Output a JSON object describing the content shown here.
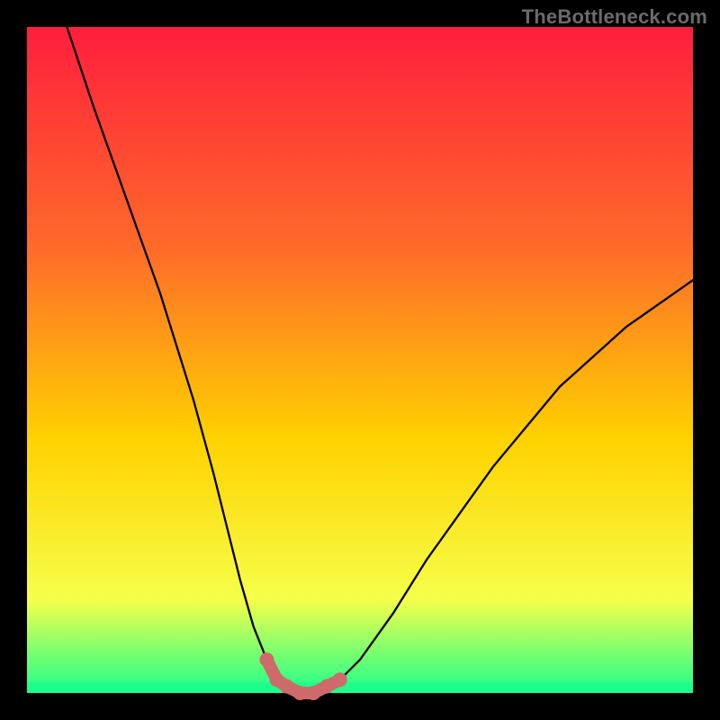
{
  "domain": "Chart",
  "watermark": "TheBottleneck.com",
  "colors": {
    "background": "#000000",
    "gradient_top": "#ff1e3d",
    "gradient_mid1": "#ff6a2a",
    "gradient_mid2": "#ffd200",
    "gradient_mid3": "#f5ff4a",
    "gradient_bottom": "#1cff8c",
    "curve": "#000000",
    "bottom_highlight": "#cf6a6a"
  },
  "chart_data": {
    "type": "line",
    "title": "",
    "xlabel": "",
    "ylabel": "",
    "xlim": [
      0,
      100
    ],
    "ylim": [
      0,
      100
    ],
    "series": [
      {
        "name": "bottleneck-curve",
        "x": [
          6,
          10,
          15,
          20,
          25,
          28,
          30,
          32,
          34,
          36,
          37.5,
          39,
          41,
          43,
          45,
          47,
          50,
          55,
          60,
          70,
          80,
          90,
          100
        ],
        "values": [
          100,
          88,
          74,
          60,
          44,
          33,
          25,
          17,
          10,
          5,
          2,
          1,
          0,
          0,
          1,
          2,
          5,
          12,
          20,
          34,
          46,
          55,
          62
        ]
      }
    ],
    "bottom_segment": {
      "x": [
        36,
        37.5,
        39,
        41,
        43,
        45,
        47
      ],
      "values": [
        5,
        2,
        1,
        0,
        0,
        1,
        2
      ]
    }
  }
}
